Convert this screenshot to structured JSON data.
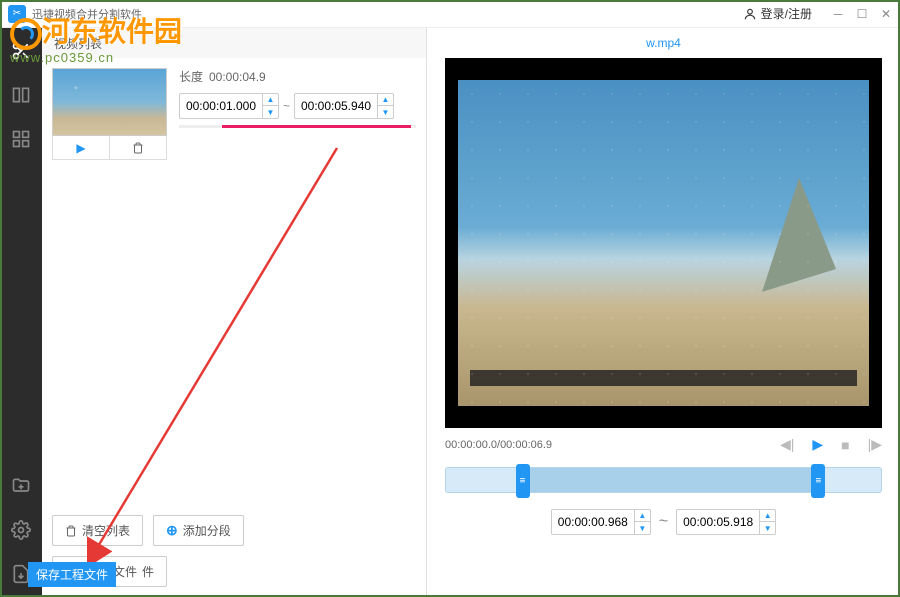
{
  "app": {
    "title": "迅捷视频合并分割软件"
  },
  "header": {
    "login": "登录/注册"
  },
  "watermark": {
    "site_name": "河东软件园",
    "site_url": "www.pc0359.cn"
  },
  "sidebar": {
    "items": [
      {
        "name": "cut",
        "active": true
      },
      {
        "name": "split"
      },
      {
        "name": "grid"
      }
    ],
    "bottom": [
      {
        "name": "add-folder"
      },
      {
        "name": "settings"
      },
      {
        "name": "export"
      }
    ]
  },
  "left": {
    "header": "视频列表",
    "item": {
      "duration_label": "长度",
      "duration": "00:00:04.9",
      "start": "00:00:01.000",
      "end": "00:00:05.940",
      "separator": "~"
    },
    "actions": {
      "clear": "清空列表",
      "add_segment": "添加分段",
      "save_project": "保存工程文件",
      "open_file_suffix": "件"
    }
  },
  "right": {
    "filename": "w.mp4",
    "time_current": "00:00:00.0",
    "time_total": "00:00:06.9",
    "range_start": "00:00:00.968",
    "range_end": "00:00:05.918",
    "separator": "~"
  },
  "tooltip": "保存工程文件"
}
